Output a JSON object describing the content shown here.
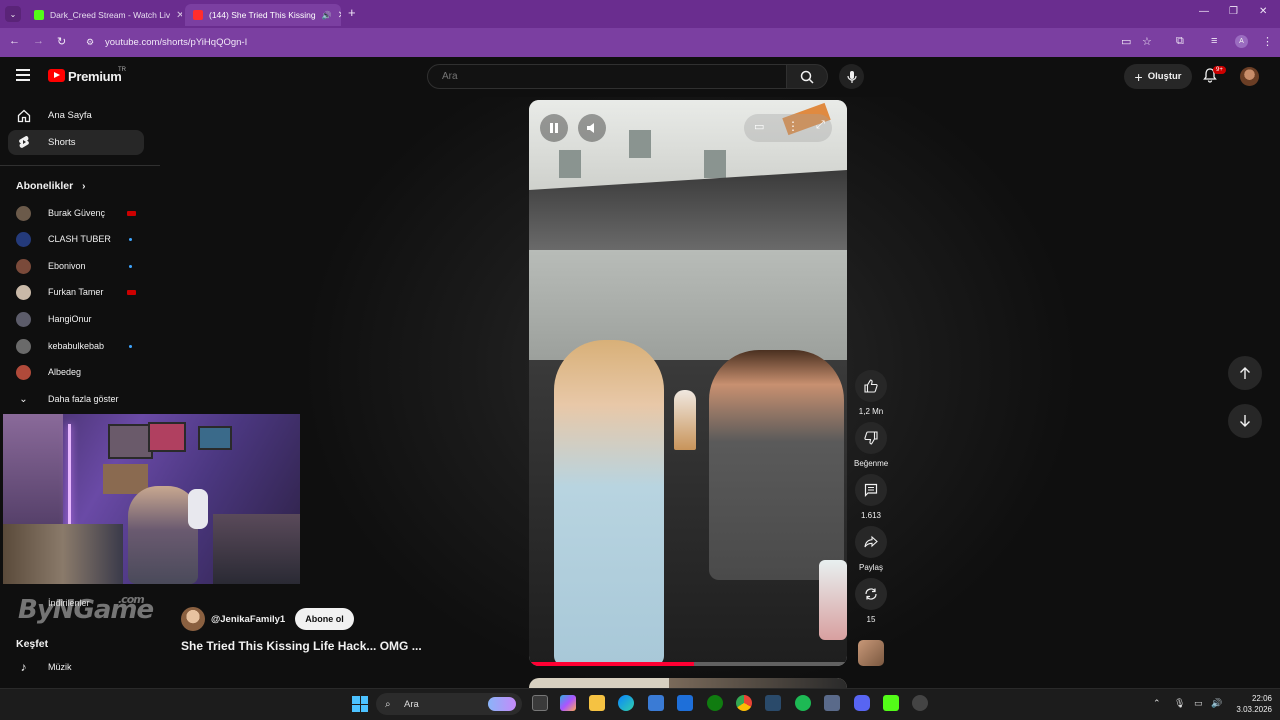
{
  "browser": {
    "tabs": [
      {
        "title": "Dark_Creed Stream - Watch Liv",
        "active": false
      },
      {
        "title": "(144) She Tried This Kissing",
        "active": true
      }
    ],
    "url": "youtube.com/shorts/pYiHqQOgn-I"
  },
  "header": {
    "brand": "Premium",
    "country": "TR",
    "search_placeholder": "Ara",
    "create_label": "Oluştur",
    "notifications_badge": "9+"
  },
  "sidebar": {
    "items": [
      {
        "label": "Ana Sayfa",
        "icon": "home-icon",
        "selected": false
      },
      {
        "label": "Shorts",
        "icon": "shorts-icon",
        "selected": true
      }
    ],
    "subscriptions_title": "Abonelikler",
    "subscriptions": [
      {
        "name": "Burak Güvenç",
        "status": "live",
        "color": "#6b5a4a"
      },
      {
        "name": "CLASH TUBER",
        "status": "new",
        "color": "#243a7a"
      },
      {
        "name": "Ebonivon",
        "status": "new",
        "color": "#7a4a3a"
      },
      {
        "name": "Furkan Tamer",
        "status": "live",
        "color": "#c9b9a8"
      },
      {
        "name": "HangiOnur",
        "status": "",
        "color": "#5c5c6a"
      },
      {
        "name": "kebabulkebab",
        "status": "new",
        "color": "#6a6a6a"
      },
      {
        "name": "Albedeg",
        "status": "",
        "color": "#b04a3a"
      }
    ],
    "show_more": "Daha fazla göster",
    "downloads": "İndirilenler",
    "explore_title": "Keşfet",
    "music": "Müzik"
  },
  "watermark": {
    "text": "ByNGame",
    "suffix": ".com"
  },
  "short": {
    "channel": "@JenikaFamily1",
    "subscribe": "Abone ol",
    "title": "She Tried This Kissing Life Hack... OMG ...",
    "likes": "1,2 Mn",
    "dislike_label": "Beğenme",
    "comments": "1.613",
    "share_label": "Paylaş",
    "remix_count": "15",
    "progress": 0.52
  },
  "taskbar": {
    "search_label": "Ara",
    "time": "22:06",
    "date": "3.03.2026"
  }
}
